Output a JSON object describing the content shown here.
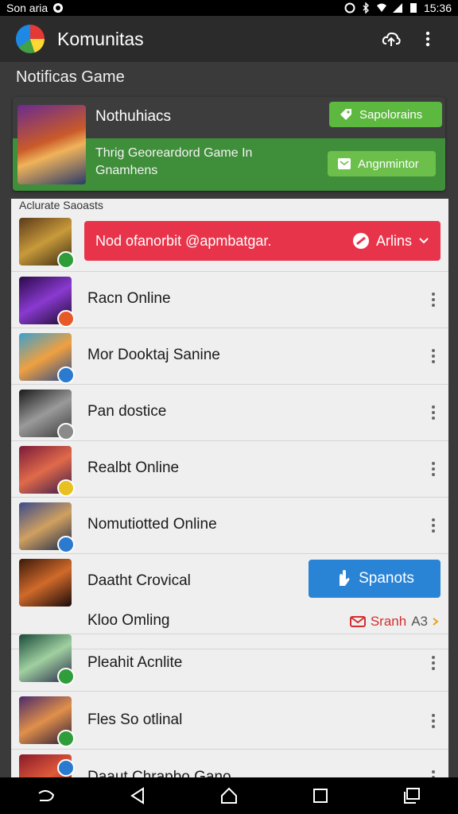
{
  "status_bar": {
    "carrier": "Son aria",
    "time": "15:36"
  },
  "app_bar": {
    "title": "Komunitas"
  },
  "section": {
    "title": "Notificas Game"
  },
  "promo": {
    "title": "Nothuhiacs",
    "text": "Thrig Georeardord Game In Gnamhens",
    "button_top": "Sapolorains",
    "button_bottom": "Angnmintor"
  },
  "list": {
    "header": "Aclurate Saoasts",
    "alert": {
      "text": "Nod ofanorbit @apmbatgar.",
      "action": "Arlins"
    },
    "items": [
      {
        "label": "Racn Online"
      },
      {
        "label": "Mor Dooktaj Sanine"
      },
      {
        "label": "Pan dostice"
      },
      {
        "label": "Realbt Online"
      },
      {
        "label": "Nomutiotted Online"
      },
      {
        "label": "Daatht Crovical"
      },
      {
        "label": "Pleahit Acnlite"
      },
      {
        "label": "Fles So otlinal"
      },
      {
        "label": "Daaut Chrapbo Gano"
      }
    ],
    "featured_button": "Spanots",
    "sub_row": {
      "label": "Kloo Omling",
      "action": "Sranh",
      "action_suffix": "A3"
    }
  },
  "colors": {
    "alert": "#e8344a",
    "promo_green": "#3f8e3a",
    "primary_button": "#2a84d6"
  }
}
